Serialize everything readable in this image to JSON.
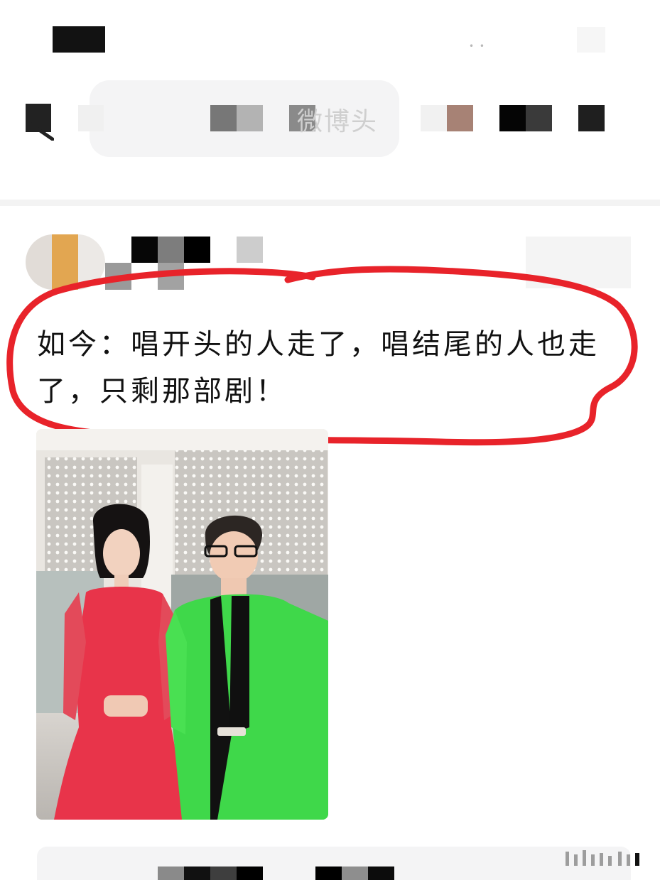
{
  "status_bar": {
    "signal_dots": "• •"
  },
  "header": {
    "search_text": "微博头"
  },
  "post": {
    "text": "如今：唱开头的人走了，唱结尾的人也走了，只剩那部剧！",
    "highlight_color": "#e8232a"
  },
  "photo": {
    "left_outfit_color": "#e8344a",
    "right_outfit_color": "#3fd84a"
  },
  "icons": {
    "back": "back-arrow-icon",
    "bottom": "bar-chart-icon"
  }
}
